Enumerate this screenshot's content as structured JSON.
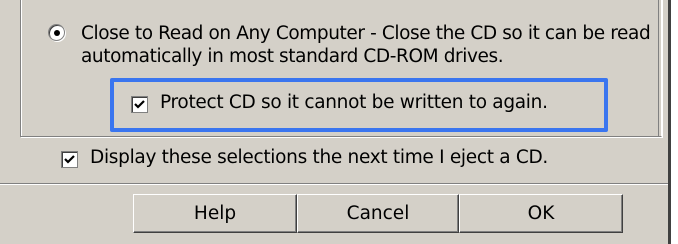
{
  "options": {
    "close_option_label": "Close to Read on Any Computer - Close the CD so it can be read automatically in most standard CD-ROM drives.",
    "close_option_selected": true,
    "protect_label": "Protect CD so it cannot be written to again.",
    "protect_checked": true,
    "display_label": "Display these selections the next time I eject a CD.",
    "display_checked": true
  },
  "buttons": {
    "help_label": "Help",
    "cancel_label": "Cancel",
    "ok_label": "OK"
  },
  "colors": {
    "dialog_background": "#d4d0c8",
    "highlight": "#3a75ef"
  },
  "icons": {
    "radio": "radio-selected-icon",
    "checkbox": "checkmark-icon"
  }
}
